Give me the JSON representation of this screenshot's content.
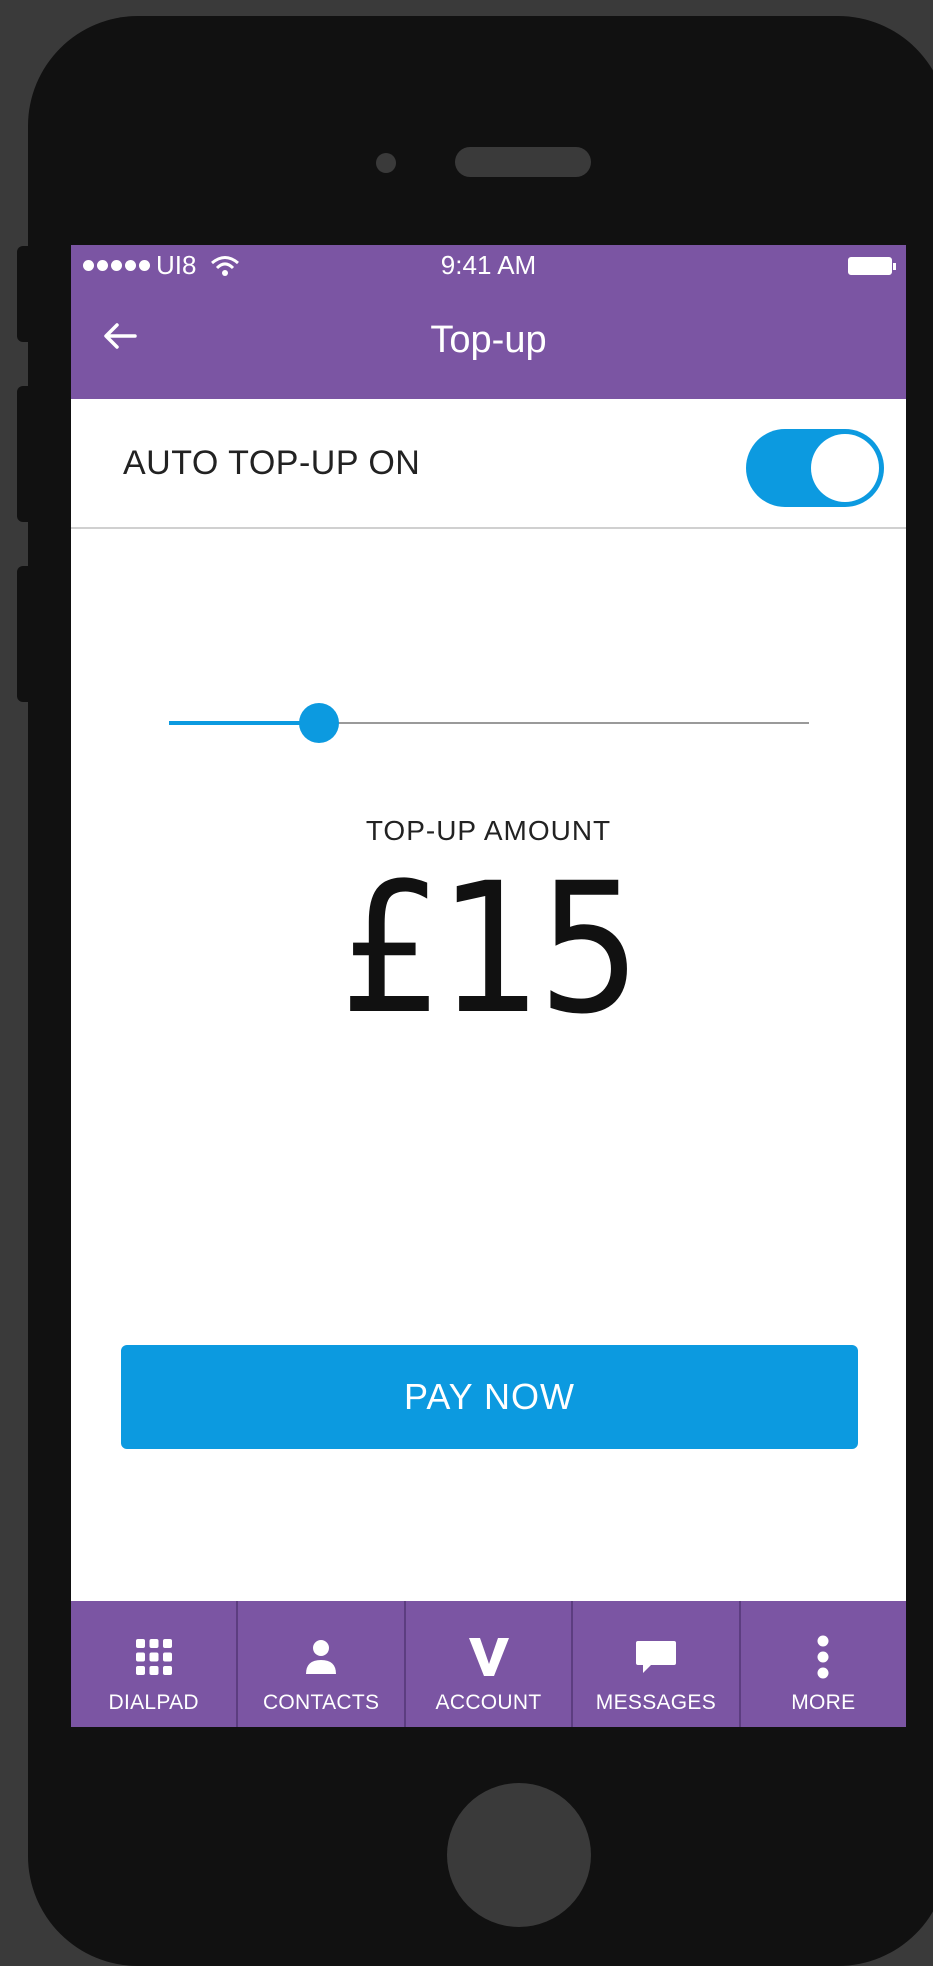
{
  "status_bar": {
    "carrier": "UI8",
    "time": "9:41 AM"
  },
  "header": {
    "back_icon": "arrow-left-icon",
    "title": "Top-up"
  },
  "auto_topup": {
    "label": "AUTO TOP-UP ON",
    "toggle_on": true
  },
  "slider": {
    "fraction": 0.235
  },
  "amount": {
    "label": "TOP-UP AMOUNT",
    "value": "£15"
  },
  "pay_button": {
    "label": "PAY NOW"
  },
  "tabbar": {
    "items": [
      {
        "label": "DIALPAD",
        "icon": "dialpad-icon"
      },
      {
        "label": "CONTACTS",
        "icon": "person-icon"
      },
      {
        "label": "ACCOUNT",
        "icon": "v-logo-icon"
      },
      {
        "label": "MESSAGES",
        "icon": "message-bubble-icon"
      },
      {
        "label": "MORE",
        "icon": "more-vertical-icon"
      }
    ]
  },
  "colors": {
    "brand_purple": "#7b55a3",
    "accent_blue": "#0c9ae0"
  }
}
